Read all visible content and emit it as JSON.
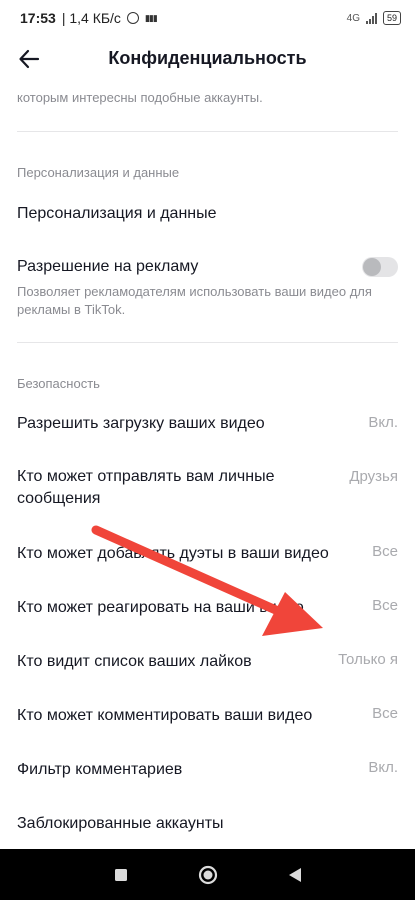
{
  "status_bar": {
    "time": "17:53",
    "speed": "1,4 КБ/с",
    "network": "4G",
    "battery": "59"
  },
  "header": {
    "title": "Конфиденциальность"
  },
  "cut_text": "которым интересны подобные аккаунты.",
  "sections": {
    "personalization": {
      "header": "Персонализация и данные",
      "item_label": "Персонализация и данные",
      "ads_label": "Разрешение на рекламу",
      "ads_desc": "Позволяет рекламодателям использовать ваши видео для рекламы в TikTok.",
      "ads_enabled": false
    },
    "security": {
      "header": "Безопасность",
      "items": [
        {
          "label": "Разрешить загрузку ваших видео",
          "value": "Вкл."
        },
        {
          "label": "Кто может отправлять вам личные сообщения",
          "value": "Друзья"
        },
        {
          "label": "Кто может добавлять дуэты в ваши видео",
          "value": "Все"
        },
        {
          "label": "Кто может реагировать на ваши видео",
          "value": "Все"
        },
        {
          "label": "Кто видит список ваших лайков",
          "value": "Только я"
        },
        {
          "label": "Кто может комментировать ваши видео",
          "value": "Все"
        },
        {
          "label": "Фильтр комментариев",
          "value": "Вкл."
        },
        {
          "label": "Заблокированные аккаунты",
          "value": ""
        }
      ]
    }
  },
  "colors": {
    "arrow": "#f0453a",
    "text_primary": "#161823",
    "text_secondary": "#8a8b91"
  }
}
